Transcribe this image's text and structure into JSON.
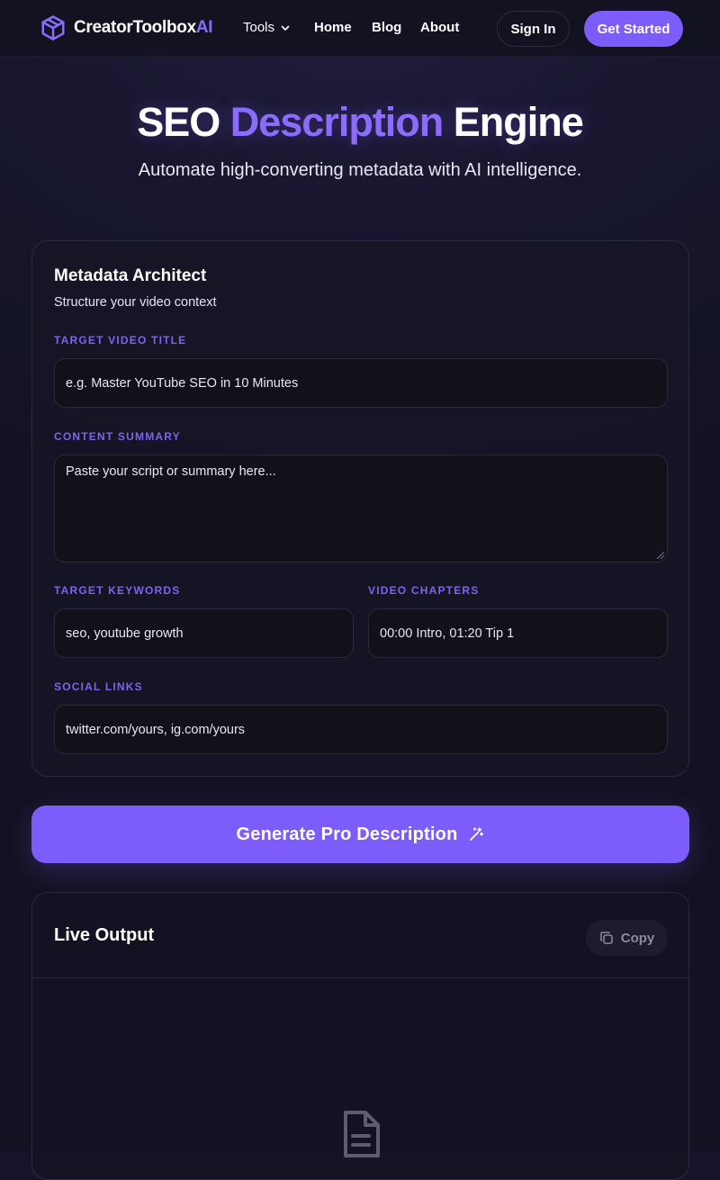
{
  "nav": {
    "logo_main": "CreatorToolbox",
    "logo_accent": "AI",
    "tools_label": "Tools",
    "home_label": "Home",
    "blog_label": "Blog",
    "about_label": "About",
    "signin_label": "Sign In",
    "get_started_label": "Get Started"
  },
  "hero": {
    "title_part1": "SEO ",
    "title_accent": "Description",
    "title_part2": " Engine",
    "subtitle": "Automate high-converting metadata with AI intelligence."
  },
  "form": {
    "title": "Metadata Architect",
    "subtitle": "Structure your video context",
    "video_title": {
      "label": "TARGET VIDEO TITLE",
      "placeholder": "e.g. Master YouTube SEO in 10 Minutes"
    },
    "summary": {
      "label": "CONTENT SUMMARY",
      "placeholder": "Paste your script or summary here..."
    },
    "keywords": {
      "label": "TARGET KEYWORDS",
      "placeholder": "seo, youtube growth"
    },
    "chapters": {
      "label": "VIDEO CHAPTERS",
      "placeholder": "00:00 Intro, 01:20 Tip 1"
    },
    "social": {
      "label": "SOCIAL LINKS",
      "placeholder": "twitter.com/yours, ig.com/yours"
    }
  },
  "generate_label": "Generate Pro Description",
  "output": {
    "title": "Live Output",
    "copy_label": "Copy"
  },
  "colors": {
    "accent": "#7c5cfa",
    "background": "#15142a",
    "label": "#7f63f0"
  },
  "icons": [
    "cube-logo-icon",
    "chevron-down-icon",
    "magic-wand-icon",
    "copy-icon",
    "document-icon"
  ]
}
